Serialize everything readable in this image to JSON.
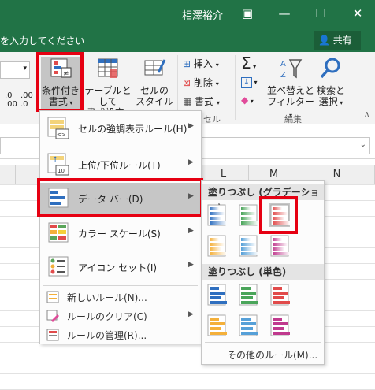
{
  "title_bar": {
    "user_name": "相澤裕介"
  },
  "tell_me": {
    "text": "を入力してください"
  },
  "share": {
    "label": "共有"
  },
  "ribbon": {
    "conditional_formatting": {
      "line1": "条件付き",
      "line2": "書式"
    },
    "format_as_table": {
      "line1": "テーブルとして",
      "line2": "書式設定"
    },
    "cell_styles": {
      "line1": "セルの",
      "line2": "スタイル"
    },
    "insert": "挿入",
    "delete": "削除",
    "format": "書式",
    "sort_filter": {
      "line1": "並べ替えと",
      "line2": "フィルター"
    },
    "find_select": {
      "line1": "検索と",
      "line2": "選択"
    },
    "number_values": [
      ".0",
      ".00",
      ".00",
      ".0"
    ],
    "groups": {
      "cells": "セル",
      "editing": "編集"
    }
  },
  "columns": [
    "L",
    "M",
    "N"
  ],
  "menu": {
    "items": [
      {
        "label": "セルの強調表示ルール(H)"
      },
      {
        "label": "上位/下位ルール(T)"
      },
      {
        "label": "データ バー(D)"
      },
      {
        "label": "カラー スケール(S)"
      },
      {
        "label": "アイコン セット(I)"
      }
    ],
    "small_items": [
      {
        "label": "新しいルール(N)..."
      },
      {
        "label": "ルールのクリア(C)"
      },
      {
        "label": "ルールの管理(R)..."
      }
    ],
    "icon_labels": [
      "≤>",
      "10"
    ]
  },
  "submenu": {
    "gradient_header": "塗りつぶし (グラデーション)",
    "solid_header": "塗りつぶし (単色)",
    "other_rules": "その他のルール(M)..."
  },
  "colors": {
    "excel_green": "#217346",
    "red_highlight": "#e60012",
    "bar_blue": "#2f6fbf",
    "bar_green": "#4aa55a",
    "bar_red": "#e14b4b",
    "bar_orange": "#f4b03a",
    "bar_lightblue": "#56a0d8",
    "bar_magenta": "#c03a8e"
  }
}
